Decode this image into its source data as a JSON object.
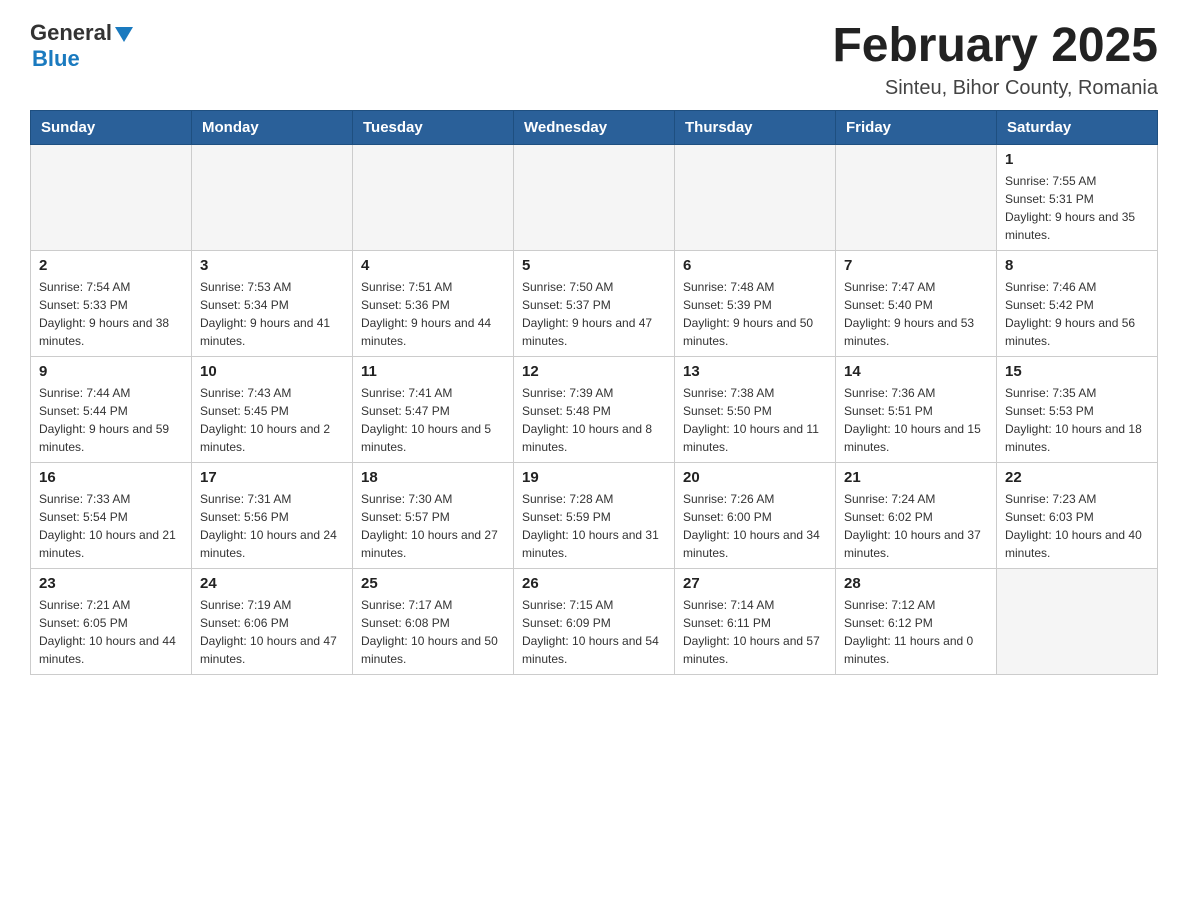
{
  "header": {
    "logo_general": "General",
    "logo_blue": "Blue",
    "title": "February 2025",
    "subtitle": "Sinteu, Bihor County, Romania"
  },
  "weekdays": [
    "Sunday",
    "Monday",
    "Tuesday",
    "Wednesday",
    "Thursday",
    "Friday",
    "Saturday"
  ],
  "weeks": [
    [
      {
        "day": "",
        "empty": true
      },
      {
        "day": "",
        "empty": true
      },
      {
        "day": "",
        "empty": true
      },
      {
        "day": "",
        "empty": true
      },
      {
        "day": "",
        "empty": true
      },
      {
        "day": "",
        "empty": true
      },
      {
        "day": "1",
        "sunrise": "Sunrise: 7:55 AM",
        "sunset": "Sunset: 5:31 PM",
        "daylight": "Daylight: 9 hours and 35 minutes."
      }
    ],
    [
      {
        "day": "2",
        "sunrise": "Sunrise: 7:54 AM",
        "sunset": "Sunset: 5:33 PM",
        "daylight": "Daylight: 9 hours and 38 minutes."
      },
      {
        "day": "3",
        "sunrise": "Sunrise: 7:53 AM",
        "sunset": "Sunset: 5:34 PM",
        "daylight": "Daylight: 9 hours and 41 minutes."
      },
      {
        "day": "4",
        "sunrise": "Sunrise: 7:51 AM",
        "sunset": "Sunset: 5:36 PM",
        "daylight": "Daylight: 9 hours and 44 minutes."
      },
      {
        "day": "5",
        "sunrise": "Sunrise: 7:50 AM",
        "sunset": "Sunset: 5:37 PM",
        "daylight": "Daylight: 9 hours and 47 minutes."
      },
      {
        "day": "6",
        "sunrise": "Sunrise: 7:48 AM",
        "sunset": "Sunset: 5:39 PM",
        "daylight": "Daylight: 9 hours and 50 minutes."
      },
      {
        "day": "7",
        "sunrise": "Sunrise: 7:47 AM",
        "sunset": "Sunset: 5:40 PM",
        "daylight": "Daylight: 9 hours and 53 minutes."
      },
      {
        "day": "8",
        "sunrise": "Sunrise: 7:46 AM",
        "sunset": "Sunset: 5:42 PM",
        "daylight": "Daylight: 9 hours and 56 minutes."
      }
    ],
    [
      {
        "day": "9",
        "sunrise": "Sunrise: 7:44 AM",
        "sunset": "Sunset: 5:44 PM",
        "daylight": "Daylight: 9 hours and 59 minutes."
      },
      {
        "day": "10",
        "sunrise": "Sunrise: 7:43 AM",
        "sunset": "Sunset: 5:45 PM",
        "daylight": "Daylight: 10 hours and 2 minutes."
      },
      {
        "day": "11",
        "sunrise": "Sunrise: 7:41 AM",
        "sunset": "Sunset: 5:47 PM",
        "daylight": "Daylight: 10 hours and 5 minutes."
      },
      {
        "day": "12",
        "sunrise": "Sunrise: 7:39 AM",
        "sunset": "Sunset: 5:48 PM",
        "daylight": "Daylight: 10 hours and 8 minutes."
      },
      {
        "day": "13",
        "sunrise": "Sunrise: 7:38 AM",
        "sunset": "Sunset: 5:50 PM",
        "daylight": "Daylight: 10 hours and 11 minutes."
      },
      {
        "day": "14",
        "sunrise": "Sunrise: 7:36 AM",
        "sunset": "Sunset: 5:51 PM",
        "daylight": "Daylight: 10 hours and 15 minutes."
      },
      {
        "day": "15",
        "sunrise": "Sunrise: 7:35 AM",
        "sunset": "Sunset: 5:53 PM",
        "daylight": "Daylight: 10 hours and 18 minutes."
      }
    ],
    [
      {
        "day": "16",
        "sunrise": "Sunrise: 7:33 AM",
        "sunset": "Sunset: 5:54 PM",
        "daylight": "Daylight: 10 hours and 21 minutes."
      },
      {
        "day": "17",
        "sunrise": "Sunrise: 7:31 AM",
        "sunset": "Sunset: 5:56 PM",
        "daylight": "Daylight: 10 hours and 24 minutes."
      },
      {
        "day": "18",
        "sunrise": "Sunrise: 7:30 AM",
        "sunset": "Sunset: 5:57 PM",
        "daylight": "Daylight: 10 hours and 27 minutes."
      },
      {
        "day": "19",
        "sunrise": "Sunrise: 7:28 AM",
        "sunset": "Sunset: 5:59 PM",
        "daylight": "Daylight: 10 hours and 31 minutes."
      },
      {
        "day": "20",
        "sunrise": "Sunrise: 7:26 AM",
        "sunset": "Sunset: 6:00 PM",
        "daylight": "Daylight: 10 hours and 34 minutes."
      },
      {
        "day": "21",
        "sunrise": "Sunrise: 7:24 AM",
        "sunset": "Sunset: 6:02 PM",
        "daylight": "Daylight: 10 hours and 37 minutes."
      },
      {
        "day": "22",
        "sunrise": "Sunrise: 7:23 AM",
        "sunset": "Sunset: 6:03 PM",
        "daylight": "Daylight: 10 hours and 40 minutes."
      }
    ],
    [
      {
        "day": "23",
        "sunrise": "Sunrise: 7:21 AM",
        "sunset": "Sunset: 6:05 PM",
        "daylight": "Daylight: 10 hours and 44 minutes."
      },
      {
        "day": "24",
        "sunrise": "Sunrise: 7:19 AM",
        "sunset": "Sunset: 6:06 PM",
        "daylight": "Daylight: 10 hours and 47 minutes."
      },
      {
        "day": "25",
        "sunrise": "Sunrise: 7:17 AM",
        "sunset": "Sunset: 6:08 PM",
        "daylight": "Daylight: 10 hours and 50 minutes."
      },
      {
        "day": "26",
        "sunrise": "Sunrise: 7:15 AM",
        "sunset": "Sunset: 6:09 PM",
        "daylight": "Daylight: 10 hours and 54 minutes."
      },
      {
        "day": "27",
        "sunrise": "Sunrise: 7:14 AM",
        "sunset": "Sunset: 6:11 PM",
        "daylight": "Daylight: 10 hours and 57 minutes."
      },
      {
        "day": "28",
        "sunrise": "Sunrise: 7:12 AM",
        "sunset": "Sunset: 6:12 PM",
        "daylight": "Daylight: 11 hours and 0 minutes."
      },
      {
        "day": "",
        "empty": true
      }
    ]
  ]
}
